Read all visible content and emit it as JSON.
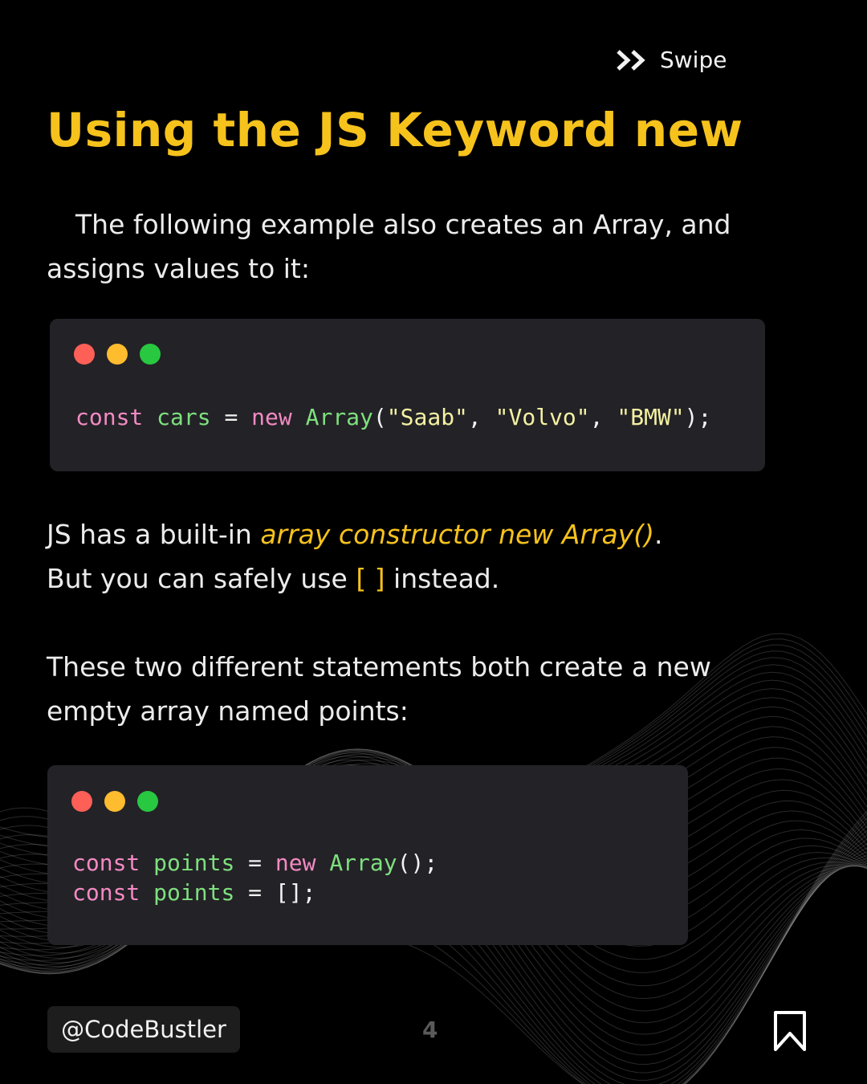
{
  "header": {
    "swipe_label": "Swipe",
    "swipe_icon": "double-chevron-right-icon"
  },
  "title": "Using the JS Keyword new",
  "intro": {
    "text": "The following example also creates an Array, and assigns values to it:"
  },
  "code_block_1": {
    "lines": [
      {
        "tokens": [
          {
            "t": "const",
            "c": "kw"
          },
          {
            "t": " ",
            "c": "pun"
          },
          {
            "t": "cars",
            "c": "id"
          },
          {
            "t": " = ",
            "c": "pun"
          },
          {
            "t": "new",
            "c": "kw"
          },
          {
            "t": " ",
            "c": "pun"
          },
          {
            "t": "Array",
            "c": "id"
          },
          {
            "t": "(",
            "c": "pun"
          },
          {
            "t": "\"Saab\"",
            "c": "str"
          },
          {
            "t": ", ",
            "c": "pun"
          },
          {
            "t": "\"Volvo\"",
            "c": "str"
          },
          {
            "t": ", ",
            "c": "pun"
          },
          {
            "t": "\"BMW\"",
            "c": "str"
          },
          {
            "t": ");",
            "c": "pun"
          }
        ]
      }
    ]
  },
  "constructor_note": {
    "prefix": "JS has a built-in ",
    "highlight": "array constructor new Array()",
    "suffix": ".",
    "line2_prefix": "But you can safely use ",
    "line2_highlight": "[ ]",
    "line2_suffix": " instead."
  },
  "points_note": {
    "text": "These two different statements both create a new empty array named points:"
  },
  "code_block_2": {
    "lines": [
      {
        "tokens": [
          {
            "t": "const",
            "c": "kw"
          },
          {
            "t": " ",
            "c": "pun"
          },
          {
            "t": "points",
            "c": "id"
          },
          {
            "t": " = ",
            "c": "pun"
          },
          {
            "t": "new",
            "c": "kw"
          },
          {
            "t": " ",
            "c": "pun"
          },
          {
            "t": "Array",
            "c": "id"
          },
          {
            "t": "();",
            "c": "pun"
          }
        ]
      },
      {
        "tokens": [
          {
            "t": "const",
            "c": "kw"
          },
          {
            "t": " ",
            "c": "pun"
          },
          {
            "t": "points",
            "c": "id"
          },
          {
            "t": " = ",
            "c": "pun"
          },
          {
            "t": "[];",
            "c": "pun"
          }
        ]
      }
    ]
  },
  "footer": {
    "handle": "@CodeBustler",
    "page_number": "4",
    "bookmark_icon": "bookmark-icon"
  },
  "colors": {
    "background": "#000000",
    "accent": "#f6c21c",
    "code_bg": "#232227",
    "keyword": "#f38ac3",
    "identifier": "#7ee07e",
    "string": "#f4f1a2"
  }
}
